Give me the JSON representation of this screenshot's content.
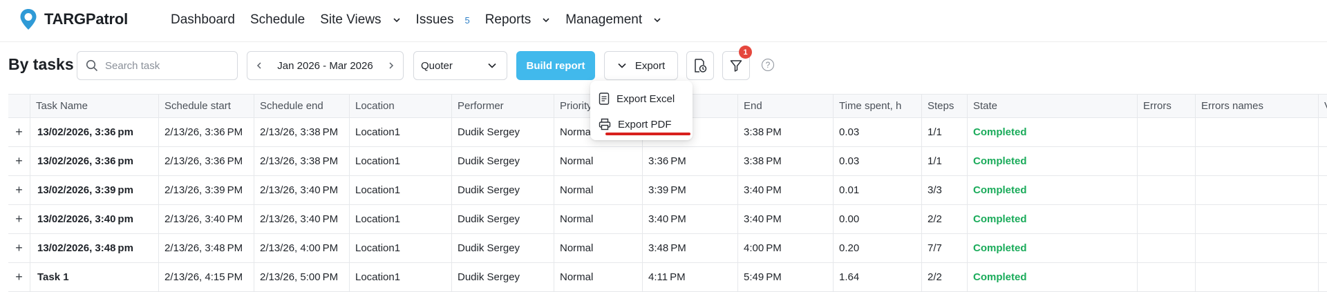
{
  "app": {
    "name": "TARGPatrol"
  },
  "nav": {
    "items": [
      {
        "label": "Dashboard"
      },
      {
        "label": "Schedule"
      },
      {
        "label": "Site Views"
      },
      {
        "label": "Issues",
        "badge": "5"
      },
      {
        "label": "Reports"
      },
      {
        "label": "Management"
      }
    ]
  },
  "toolbar": {
    "title": "By tasks",
    "search_placeholder": "Search task",
    "date_range": "Jan 2026 - Mar 2026",
    "role_select": "Quoter",
    "build_label": "Build report",
    "export_label": "Export",
    "filter_count": "1",
    "help": "?"
  },
  "export_menu": {
    "items": [
      {
        "label": "Export Excel",
        "icon": "file-icon"
      },
      {
        "label": "Export PDF",
        "icon": "printer-icon"
      }
    ]
  },
  "table": {
    "columns": [
      "Task Name",
      "Schedule start",
      "Schedule end",
      "Location",
      "Performer",
      "Priority",
      "",
      "End",
      "Time spent, h",
      "Steps",
      "State",
      "Errors",
      "Errors names",
      "V"
    ],
    "rows": [
      [
        "13/02/2026, 3:36 pm",
        "2/13/26, 3:36 PM",
        "2/13/26, 3:38 PM",
        "Location1",
        "Dudik Sergey",
        "Normal",
        "",
        "3:38 PM",
        "0.03",
        "1/1",
        "Completed",
        "",
        ""
      ],
      [
        "13/02/2026, 3:36 pm",
        "2/13/26, 3:36 PM",
        "2/13/26, 3:38 PM",
        "Location1",
        "Dudik Sergey",
        "Normal",
        "3:36 PM",
        "3:38 PM",
        "0.03",
        "1/1",
        "Completed",
        "",
        ""
      ],
      [
        "13/02/2026, 3:39 pm",
        "2/13/26, 3:39 PM",
        "2/13/26, 3:40 PM",
        "Location1",
        "Dudik Sergey",
        "Normal",
        "3:39 PM",
        "3:40 PM",
        "0.01",
        "3/3",
        "Completed",
        "",
        ""
      ],
      [
        "13/02/2026, 3:40 pm",
        "2/13/26, 3:40 PM",
        "2/13/26, 3:40 PM",
        "Location1",
        "Dudik Sergey",
        "Normal",
        "3:40 PM",
        "3:40 PM",
        "0.00",
        "2/2",
        "Completed",
        "",
        ""
      ],
      [
        "13/02/2026, 3:48 pm",
        "2/13/26, 3:48 PM",
        "2/13/26, 4:00 PM",
        "Location1",
        "Dudik Sergey",
        "Normal",
        "3:48 PM",
        "4:00 PM",
        "0.20",
        "7/7",
        "Completed",
        "",
        ""
      ],
      [
        "Task 1",
        "2/13/26, 4:15 PM",
        "2/13/26, 5:00 PM",
        "Location1",
        "Dudik Sergey",
        "Normal",
        "4:11 PM",
        "5:49 PM",
        "1.64",
        "2/2",
        "Completed",
        "",
        ""
      ]
    ]
  },
  "colors": {
    "accent": "#41b9ec",
    "completed": "#1aab5a",
    "badge": "#e5473d",
    "brand": "#2f9ad6"
  }
}
